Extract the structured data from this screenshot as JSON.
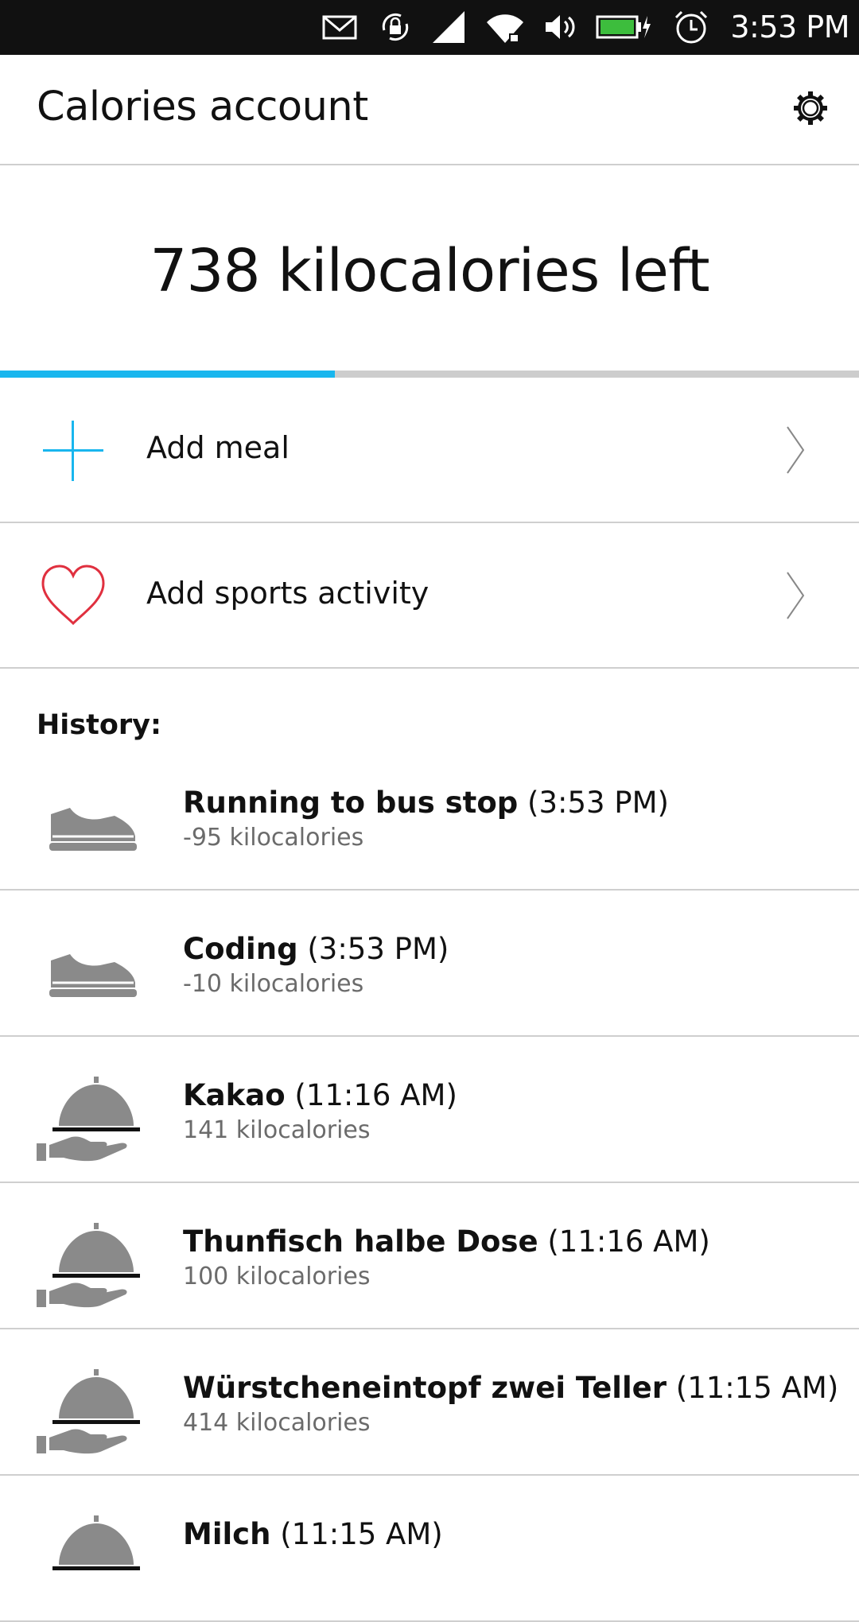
{
  "status_bar": {
    "time": "3:53 PM",
    "icons": [
      "mail-icon",
      "rotation-lock-icon",
      "signal-icon",
      "wifi-icon",
      "volume-icon",
      "battery-charging-icon",
      "alarm-icon"
    ]
  },
  "header": {
    "title": "Calories account",
    "settings_icon": "gear-icon"
  },
  "summary": {
    "text": "738 kilocalories left",
    "progress_fraction": 0.39,
    "accent_color": "#19b6ee"
  },
  "actions": [
    {
      "label": "Add meal",
      "icon": "plus-icon",
      "icon_color": "#19b6ee"
    },
    {
      "label": "Add sports activity",
      "icon": "heart-icon",
      "icon_color": "#e0303f"
    }
  ],
  "history": {
    "heading": "History:",
    "items": [
      {
        "name": "Running to bus stop",
        "time": "(3:53 PM)",
        "calories": "-95 kilocalories",
        "icon": "sneaker-icon"
      },
      {
        "name": "Coding",
        "time": "(3:53 PM)",
        "calories": "-10 kilocalories",
        "icon": "sneaker-icon"
      },
      {
        "name": "Kakao",
        "time": "(11:16 AM)",
        "calories": "141 kilocalories",
        "icon": "served-meal-icon"
      },
      {
        "name": "Thunfisch halbe Dose",
        "time": "(11:16 AM)",
        "calories": "100 kilocalories",
        "icon": "served-meal-icon"
      },
      {
        "name": "Würstcheneintopf zwei Teller",
        "time": "(11:15 AM)",
        "calories": "414 kilocalories",
        "icon": "served-meal-icon"
      },
      {
        "name": "Milch",
        "time": "(11:15 AM)",
        "calories": "",
        "icon": "served-meal-icon"
      }
    ]
  }
}
